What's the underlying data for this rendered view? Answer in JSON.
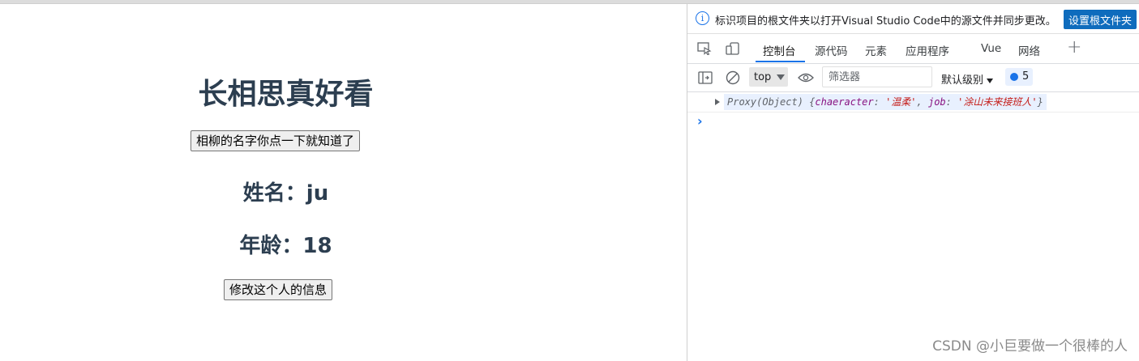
{
  "app": {
    "title": "长相思真好看",
    "reveal_button": "相柳的名字你点一下就知道了",
    "name_label": "姓名：",
    "name_value": "ju",
    "age_label": "年龄：",
    "age_value": "18",
    "modify_button": "修改这个人的信息"
  },
  "devtools": {
    "infobar": {
      "icon": "info-icon",
      "message": "标识项目的根文件夹以打开Visual Studio Code中的源文件并同步更改。",
      "button": "设置根文件夹"
    },
    "tabs": [
      {
        "label": "控制台",
        "active": true
      },
      {
        "label": "源代码",
        "active": false
      },
      {
        "label": "元素",
        "active": false
      },
      {
        "label": "应用程序",
        "active": false
      },
      {
        "label": "Vue",
        "active": false
      },
      {
        "label": "网络",
        "active": false
      }
    ],
    "toolbar": {
      "context": "top",
      "filter_placeholder": "筛选器",
      "level": "默认级别",
      "message_count": "5"
    },
    "console": {
      "log": {
        "prefix": "Proxy(Object) {",
        "key1": "chaeracter",
        "val1": "'温柔'",
        "key2": "job",
        "val2": "'涂山未来接班人'",
        "suffix": "}"
      },
      "prompt": "›"
    }
  },
  "watermark": "CSDN @小巨要做一个很棒的人",
  "colors": {
    "heading": "#2c3e50",
    "accent": "#1a73e8",
    "infobar_button": "#0f6cbd"
  }
}
